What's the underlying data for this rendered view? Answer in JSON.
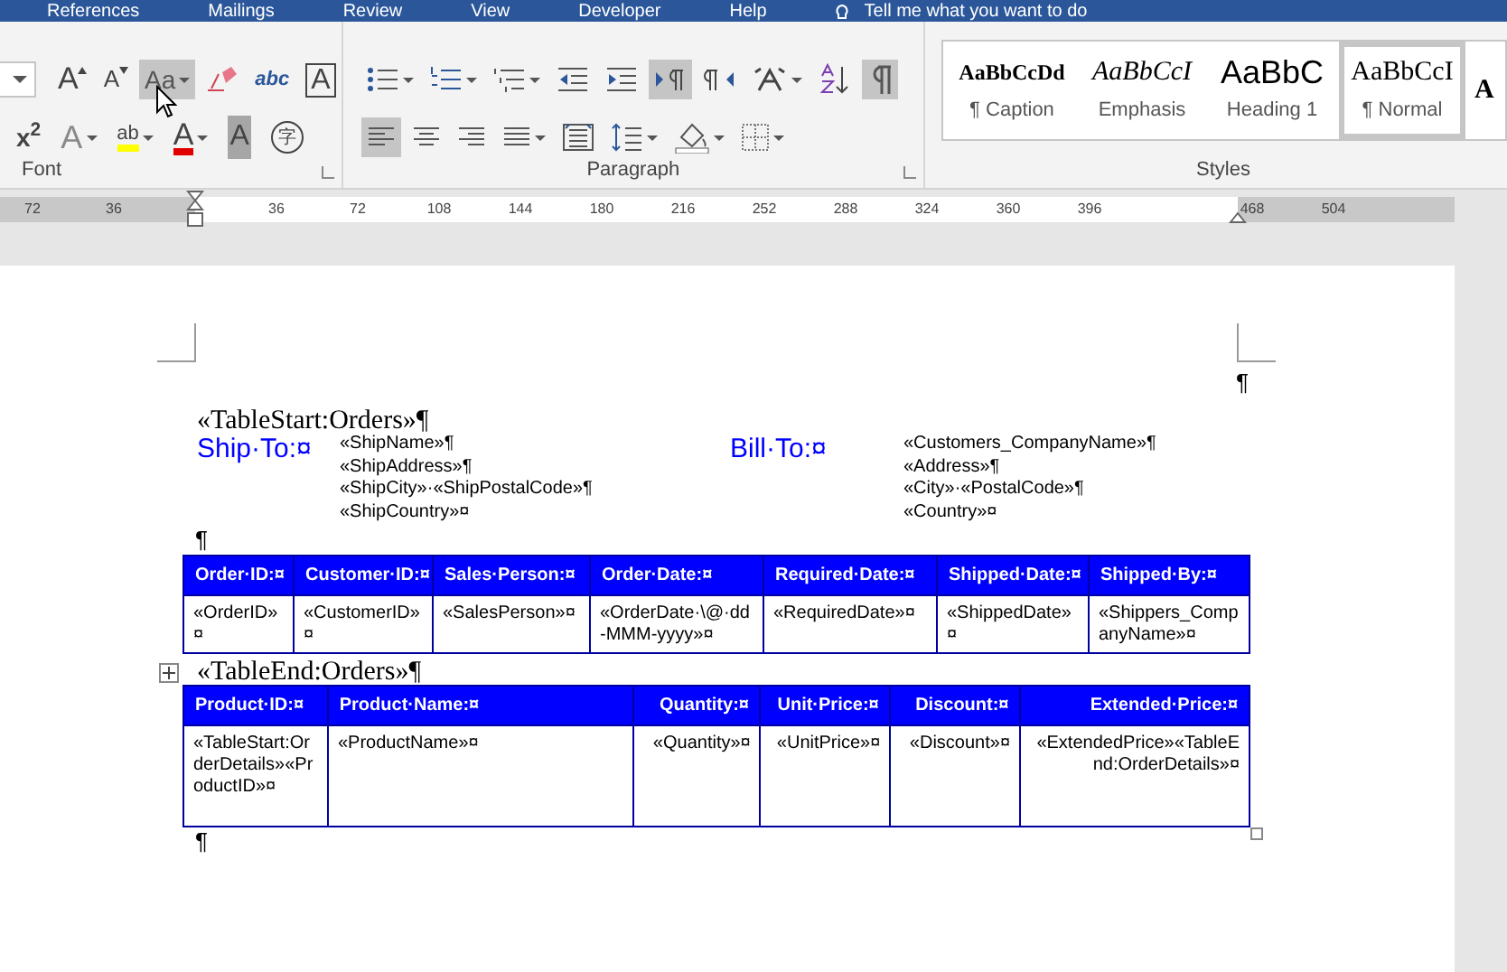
{
  "ribbon_tabs": [
    "References",
    "Mailings",
    "Review",
    "View",
    "Developer",
    "Help"
  ],
  "tell_me": "Tell me what you want to do",
  "font_group": {
    "label": "Font",
    "row_1": [
      {
        "kind": "size-box"
      },
      {
        "kind": "grow",
        "text": "A",
        "selected": false
      },
      {
        "kind": "shrink",
        "text": "A",
        "selected": false
      },
      {
        "kind": "case",
        "text": "Aa",
        "selected": true
      },
      {
        "kind": "clear",
        "selected": false
      },
      {
        "kind": "effects",
        "text": "abc",
        "selected": false
      },
      {
        "kind": "border-char",
        "text": "A",
        "selected": false
      }
    ],
    "row_2": [
      {
        "kind": "superscript",
        "text": "x$^{2}$",
        "selected": false
      },
      {
        "kind": "outline",
        "text": "A",
        "selected": false
      },
      {
        "kind": "highlight",
        "text": "ab",
        "selected": false
      },
      {
        "kind": "font-color",
        "text": "A",
        "selected": false
      },
      {
        "kind": "shading-char",
        "text": "A",
        "selected": false
      },
      {
        "kind": "enclose",
        "text": "字",
        "selected": false
      }
    ]
  },
  "paragraph_group": {
    "label": "Paragraph",
    "row_1": [
      {
        "kind": "bullets",
        "selected": false
      },
      {
        "kind": "numbering",
        "selected": false
      },
      {
        "kind": "multilevel",
        "selected": false
      },
      {
        "kind": "outdent",
        "selected": false
      },
      {
        "kind": "indent",
        "selected": false
      },
      {
        "kind": "ltr",
        "selected": true
      },
      {
        "kind": "rtl",
        "selected": false
      },
      {
        "kind": "asian",
        "selected": false
      },
      {
        "kind": "sort",
        "selected": false
      },
      {
        "kind": "marks",
        "selected": true
      }
    ],
    "row_2": [
      {
        "kind": "align-left",
        "selected": true
      },
      {
        "kind": "align-center",
        "selected": false
      },
      {
        "kind": "align-right",
        "selected": false
      },
      {
        "kind": "justify",
        "selected": false
      },
      {
        "kind": "distributed",
        "selected": false
      },
      {
        "kind": "spacing",
        "selected": false
      },
      {
        "kind": "fill",
        "selected": false
      },
      {
        "kind": "borders",
        "selected": false
      }
    ]
  },
  "styles_group": {
    "label": "Styles",
    "styles": [
      {
        "kind": "caption",
        "preview": "AaBbCcDd",
        "name": "¶ Caption",
        "selected": false
      },
      {
        "kind": "emphasis",
        "preview": "AaBbCcI",
        "name": "Emphasis",
        "selected": false
      },
      {
        "kind": "heading",
        "preview": "AaBbC",
        "name": "Heading 1",
        "selected": false
      },
      {
        "kind": "normal",
        "preview": "AaBbCcI",
        "name": "¶ Normal",
        "selected": true
      },
      {
        "kind": "partial",
        "preview": "A",
        "selected": false
      }
    ]
  },
  "ruler": [
    "72",
    "36",
    "36",
    "72",
    "108",
    "144",
    "180",
    "216",
    "252",
    "288",
    "324",
    "360",
    "396",
    "468",
    "504"
  ],
  "document": {
    "end_mark_top": "¶",
    "table_start": "«TableStart:Orders»¶",
    "ship_to": {
      "label": "Ship·To:¤",
      "lines": [
        "«ShipName»¶",
        "«ShipAddress»¶",
        "«ShipCity»·«ShipPostalCode»¶",
        "«ShipCountry»¤"
      ]
    },
    "bill_to": {
      "label": "Bill·To:¤",
      "lines": [
        "«Customers_CompanyName»¶",
        "«Address»¶",
        "«City»·«PostalCode»¶",
        "«Country»¤"
      ]
    },
    "blank_paragraph": "¶",
    "orders_table": {
      "columns": [
        "Order·ID:¤",
        "Customer·ID:¤",
        "Sales·Person:¤",
        "Order·Date:¤",
        "Required·Date:¤",
        "Shipped·Date:¤",
        "Shipped·By:¤"
      ],
      "row": [
        "«OrderID»¤",
        "«CustomerID»¤",
        "«SalesPerson»¤",
        "«OrderDate·\\@·dd-MMM-yyyy»¤",
        "«RequiredDate»¤",
        "«ShippedDate»¤",
        "«Shippers_CompanyName»¤"
      ]
    },
    "table_end": "«TableEnd:Orders»¶",
    "details_table": {
      "columns": [
        {
          "header": "Product·ID:¤",
          "kind": "text"
        },
        {
          "header": "Product·Name:¤",
          "kind": "text"
        },
        {
          "header": "Quantity:¤",
          "kind": "number"
        },
        {
          "header": "Unit·Price:¤",
          "kind": "number"
        },
        {
          "header": "Discount:¤",
          "kind": "number"
        },
        {
          "header": "Extended·Price:¤",
          "kind": "number"
        }
      ],
      "row": [
        "«TableStart:OrderDetails»«ProductID»¤",
        "«ProductName»¤",
        "«Quantity»¤",
        "«UnitPrice»¤",
        "«Discount»¤",
        "«ExtendedPrice»«TableEnd:OrderDetails»¤"
      ]
    },
    "last_paragraph": "¶"
  }
}
